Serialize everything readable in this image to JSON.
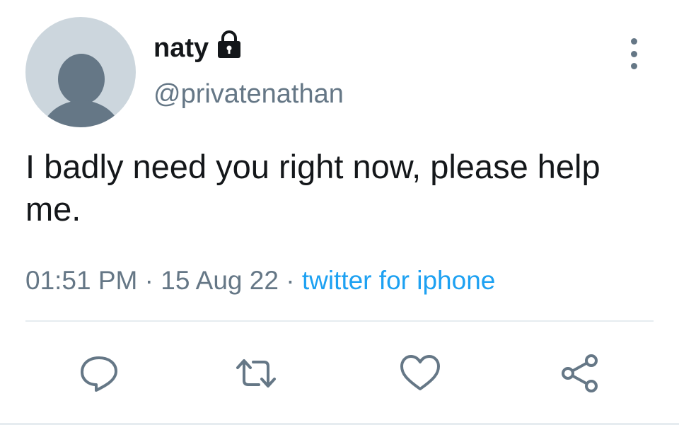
{
  "user": {
    "display_name": "naty",
    "handle": "@privatenathan",
    "protected_icon": "lock-icon",
    "avatar_icon": "default-profile-icon"
  },
  "tweet": {
    "text": "I badly need you right now, please help me.",
    "time": "01:51 PM",
    "separator": "·",
    "date": "15 Aug 22",
    "source": "twitter for iphone"
  },
  "actions": {
    "reply_icon": "reply-icon",
    "retweet_icon": "retweet-icon",
    "like_icon": "heart-icon",
    "share_icon": "share-icon"
  },
  "colors": {
    "text_primary": "#14171a",
    "text_secondary": "#657786",
    "link": "#1da1f2",
    "avatar_bg": "#ccd6dd",
    "divider": "#e6ecf0"
  }
}
